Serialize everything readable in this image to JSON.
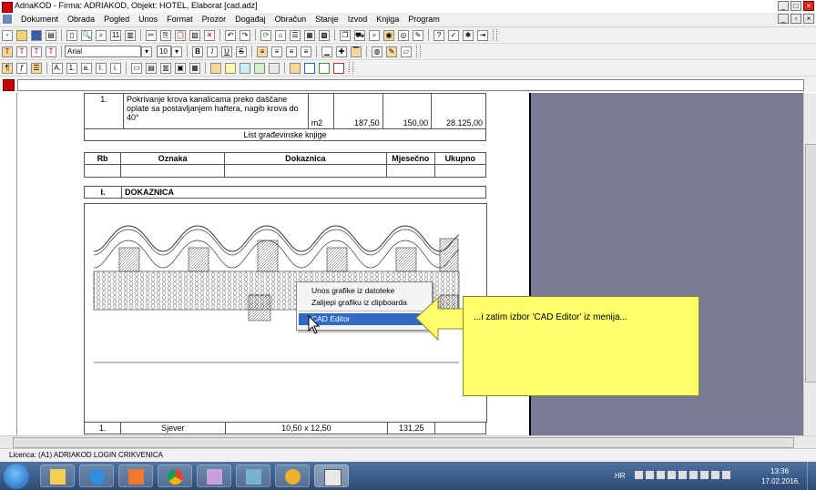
{
  "window": {
    "title": "AdriaKOD - Firma: ADRIAKOD,   Objekt: HOTEL, Elaborat [cad.adz]"
  },
  "menu": {
    "items": [
      "Dokument",
      "Obrada",
      "Pogled",
      "Unos",
      "Format",
      "Prozor",
      "Događaj",
      "Obračun",
      "Stanje",
      "Izvod",
      "Knjiga",
      "Program"
    ]
  },
  "toolbar": {
    "font_name": "Arial",
    "font_size": "10"
  },
  "table": {
    "top_row": {
      "rb": "1.",
      "description": "Pokrivanje krova kanalicama preko daščane oplate sa postavljanjem haftera, nagib krova do 40°",
      "unit": "m2",
      "quantity": "187,50",
      "price": "150,00",
      "total": "28.125,00"
    },
    "sheet_title": "List građevinske knjige",
    "headers": {
      "rb": "Rb",
      "oznaka": "Oznaka",
      "dokaznica": "Dokaznica",
      "mjesecno": "Mjesečno",
      "ukupno": "Ukupno"
    },
    "section_number": "I.",
    "section_title": "DOKAZNICA",
    "bottom_row": {
      "rb": "1.",
      "oznaka": "Sjever",
      "dokaznica": "10,50 x 12,50",
      "mjesecno": "131,25"
    }
  },
  "context_menu": {
    "items": [
      {
        "label": "Unos grafike iz datoteke"
      },
      {
        "label": "Zalijepi grafiku iz clipboarda"
      },
      {
        "label": "CAD Editor"
      }
    ]
  },
  "callout": {
    "text": "...i zatim izbor 'CAD Editor' iz menija..."
  },
  "status": {
    "text": "Licenca: (A1) ADRIAKOD LOGIN CRIKVENICA"
  },
  "tray": {
    "lang": "HR",
    "time": "13:36",
    "date": "17.02.2016."
  },
  "colors": {
    "page_background": "#7a7a96",
    "callout": "#ffff6e",
    "menu_highlight": "#316ac5"
  }
}
